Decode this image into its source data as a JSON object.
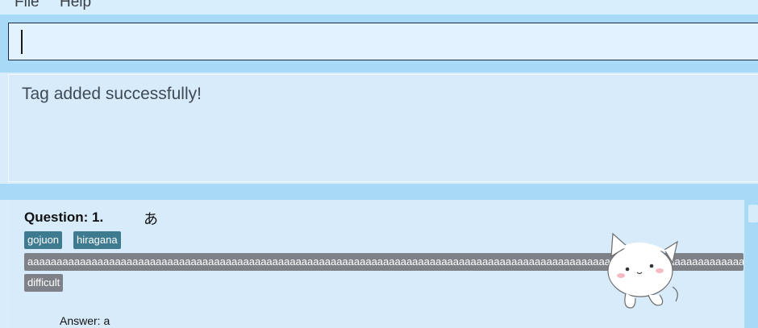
{
  "menu": {
    "file_label": "File",
    "help_label": "Help"
  },
  "command_box": {
    "value": ""
  },
  "result": {
    "message": "Tag added successfully!"
  },
  "card": {
    "question_label": "Question: 1.",
    "question_text": "あ",
    "tags": [
      "gojuon",
      "hiragana"
    ],
    "long_tag": "aaaaaaaaaaaaaaaaaaaaaaaaaaaaaaaaaaaaaaaaaaaaaaaaaaaaaaaaaaaaaaaaaaaaaaaaaaaaaaaaaaaaaaaaaaaaaaaaaaaaaaaaaaaaaaaaaaaaaaaaaaaaaaaaaaaaaaaaaaaaaaaaaaaaaa",
    "difficulty_tag": "difficult",
    "answer": "Answer: a"
  },
  "colors": {
    "accent_tag": "#3e7b91",
    "grey_tag": "#7e8288",
    "panel_bg": "#d8ebfb",
    "band": "#a8d9f7"
  },
  "icons": {
    "mascot": "cat-mascot-icon"
  }
}
